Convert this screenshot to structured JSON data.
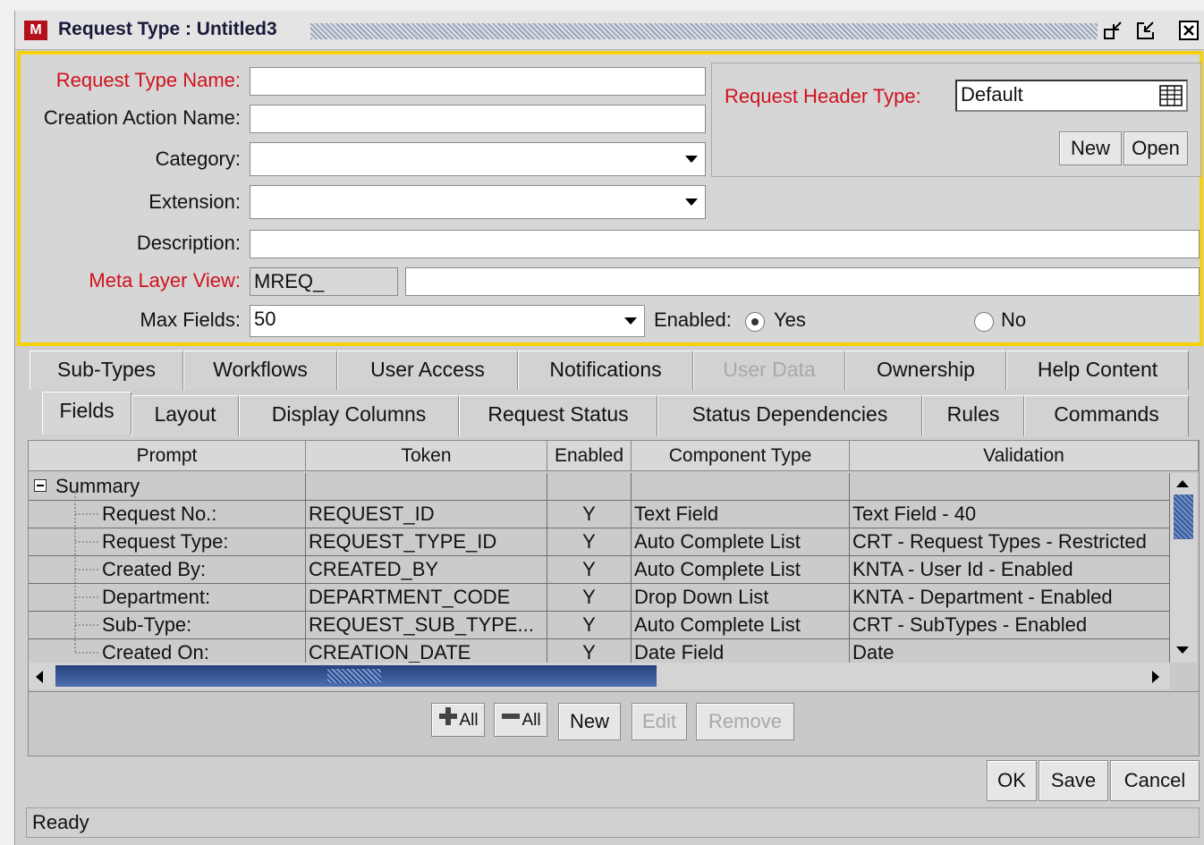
{
  "window": {
    "title": "Request Type : Untitled3",
    "logo_letter": "M",
    "accent_color": "#f5d10a",
    "brand_color": "#b3121c"
  },
  "form": {
    "request_type_name_label": "Request Type Name:",
    "request_type_name_value": "",
    "creation_action_name_label": "Creation Action Name:",
    "creation_action_name_value": "",
    "category_label": "Category:",
    "category_value": "",
    "extension_label": "Extension:",
    "extension_value": "",
    "description_label": "Description:",
    "description_value": "",
    "meta_layer_view_label": "Meta Layer View:",
    "meta_layer_view_prefix": "MREQ_",
    "meta_layer_view_value": "",
    "max_fields_label": "Max Fields:",
    "max_fields_value": "50",
    "enabled_label": "Enabled:",
    "enabled_yes": "Yes",
    "enabled_no": "No",
    "enabled_selected": "Yes",
    "request_header_type_label": "Request Header Type:",
    "request_header_type_value": "Default",
    "header_new_button": "New",
    "header_open_button": "Open"
  },
  "tabs_row1": [
    {
      "label": "Sub-Types",
      "enabled": true
    },
    {
      "label": "Workflows",
      "enabled": true
    },
    {
      "label": "User Access",
      "enabled": true
    },
    {
      "label": "Notifications",
      "enabled": true
    },
    {
      "label": "User Data",
      "enabled": false
    },
    {
      "label": "Ownership",
      "enabled": true
    },
    {
      "label": "Help Content",
      "enabled": true
    }
  ],
  "tabs_row2": [
    {
      "label": "Fields",
      "active": true
    },
    {
      "label": "Layout"
    },
    {
      "label": "Display Columns"
    },
    {
      "label": "Request Status"
    },
    {
      "label": "Status Dependencies"
    },
    {
      "label": "Rules"
    },
    {
      "label": "Commands"
    }
  ],
  "grid": {
    "columns": [
      "Prompt",
      "Token",
      "Enabled",
      "Component Type",
      "Validation"
    ],
    "group": "Summary",
    "rows": [
      [
        "Request No.:",
        "REQUEST_ID",
        "Y",
        "Text Field",
        "Text Field - 40"
      ],
      [
        "Request Type:",
        "REQUEST_TYPE_ID",
        "Y",
        "Auto Complete List",
        "CRT - Request Types - Restricted"
      ],
      [
        "Created By:",
        "CREATED_BY",
        "Y",
        "Auto Complete List",
        "KNTA - User Id - Enabled"
      ],
      [
        "Department:",
        "DEPARTMENT_CODE",
        "Y",
        "Drop Down List",
        "KNTA - Department - Enabled"
      ],
      [
        "Sub-Type:",
        "REQUEST_SUB_TYPE...",
        "Y",
        "Auto Complete List",
        "CRT - SubTypes - Enabled"
      ],
      [
        "Created On:",
        "CREATION_DATE",
        "Y",
        "Date Field",
        "Date"
      ]
    ]
  },
  "grid_buttons": {
    "expand_all": "All",
    "collapse_all": "All",
    "new": "New",
    "edit": "Edit",
    "remove": "Remove"
  },
  "footer": {
    "ok": "OK",
    "save": "Save",
    "cancel": "Cancel",
    "status": "Ready"
  }
}
